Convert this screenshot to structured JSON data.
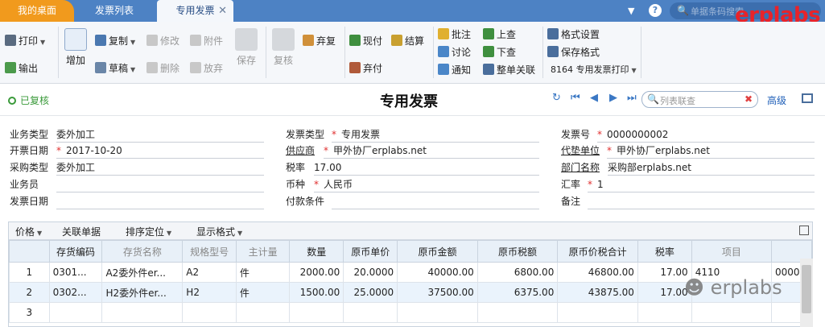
{
  "tabs": [
    {
      "label": "我的桌面"
    },
    {
      "label": "发票列表"
    },
    {
      "label": "专用发票"
    }
  ],
  "top_search": {
    "placeholder": "单据条码搜索"
  },
  "watermark": "erplabs",
  "toolbar": {
    "print": "打印",
    "export": "输出",
    "add": "增加",
    "copy": "复制",
    "draft": "草稿",
    "modify": "修改",
    "delete": "删除",
    "attach": "附件",
    "abandon_disabled": "放弃",
    "save": "保存",
    "review": "复核",
    "discard": "弃复",
    "cash": "现付",
    "settle": "结算",
    "discard_pay": "弃付",
    "annotate": "批注",
    "discuss": "讨论",
    "notify": "通知",
    "prev_lookup": "上查",
    "next_lookup": "下查",
    "link_all": "整单关联",
    "format_settings": "格式设置",
    "save_format": "保存格式",
    "format_select": "8164 专用发票打印"
  },
  "title_bar": {
    "status": "已复核",
    "title": "专用发票",
    "list_search_placeholder": "列表联查",
    "advanced": "高级"
  },
  "form": {
    "business_type": {
      "label": "业务类型",
      "value": "委外加工"
    },
    "invoice_date": {
      "label": "开票日期",
      "value": "2017-10-20"
    },
    "purchase_type": {
      "label": "采购类型",
      "value": "委外加工"
    },
    "salesperson": {
      "label": "业务员",
      "value": ""
    },
    "send_date": {
      "label": "发票日期",
      "value": ""
    },
    "invoice_type": {
      "label": "发票类型",
      "value": "专用发票"
    },
    "supplier": {
      "label": "供应商",
      "value": "甲外协厂erplabs.net"
    },
    "tax_rate": {
      "label": "税率",
      "value": "17.00"
    },
    "currency": {
      "label": "币种",
      "value": "人民币"
    },
    "payment_terms": {
      "label": "付款条件",
      "value": ""
    },
    "invoice_no": {
      "label": "发票号",
      "value": "0000000002"
    },
    "advance_unit": {
      "label": "代垫单位",
      "value": "甲外协厂erplabs.net"
    },
    "dept": {
      "label": "部门名称",
      "value": "采购部erplabs.net"
    },
    "exchange_rate": {
      "label": "汇率",
      "value": "1"
    },
    "remark": {
      "label": "备注",
      "value": ""
    }
  },
  "grid_toolbar": {
    "price": "价格",
    "link_doc": "关联单据",
    "sort": "排序定位",
    "display_format": "显示格式"
  },
  "grid": {
    "headers": [
      "存货编码",
      "存货名称",
      "规格型号",
      "主计量",
      "数量",
      "原币单价",
      "原币金额",
      "原币税额",
      "原币价税合计",
      "税率",
      "项目"
    ],
    "rows": [
      {
        "idx": "1",
        "code": "0301...",
        "name": "A2委外件er...",
        "spec": "A2",
        "unit": "件",
        "qty": "2000.00",
        "price": "20.0000",
        "amount": "40000.00",
        "tax": "6800.00",
        "total": "46800.00",
        "rate": "17.00",
        "project": "4110",
        "extra": "0000"
      },
      {
        "idx": "2",
        "code": "0302...",
        "name": "H2委外件er...",
        "spec": "H2",
        "unit": "件",
        "qty": "1500.00",
        "price": "25.0000",
        "amount": "37500.00",
        "tax": "6375.00",
        "total": "43875.00",
        "rate": "17.00",
        "project": "",
        "extra": ""
      },
      {
        "idx": "3",
        "code": "",
        "name": "",
        "spec": "",
        "unit": "",
        "qty": "",
        "price": "",
        "amount": "",
        "tax": "",
        "total": "",
        "rate": "",
        "project": "",
        "extra": ""
      }
    ]
  },
  "bottom_watermark": "erplabs",
  "colors": {
    "tab_bar": "#4d82c4",
    "active_desk_tab": "#f19a1d",
    "status_green": "#3a9a3a",
    "required_red": "#e03030"
  }
}
